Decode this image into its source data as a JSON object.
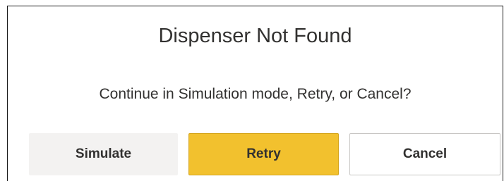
{
  "dialog": {
    "title": "Dispenser Not Found",
    "message": "Continue in Simulation mode, Retry, or Cancel?",
    "buttons": {
      "simulate_label": "Simulate",
      "retry_label": "Retry",
      "cancel_label": "Cancel"
    }
  },
  "colors": {
    "primary_button": "#f2c12e",
    "secondary_button": "#f3f2f1",
    "text": "#323130"
  }
}
